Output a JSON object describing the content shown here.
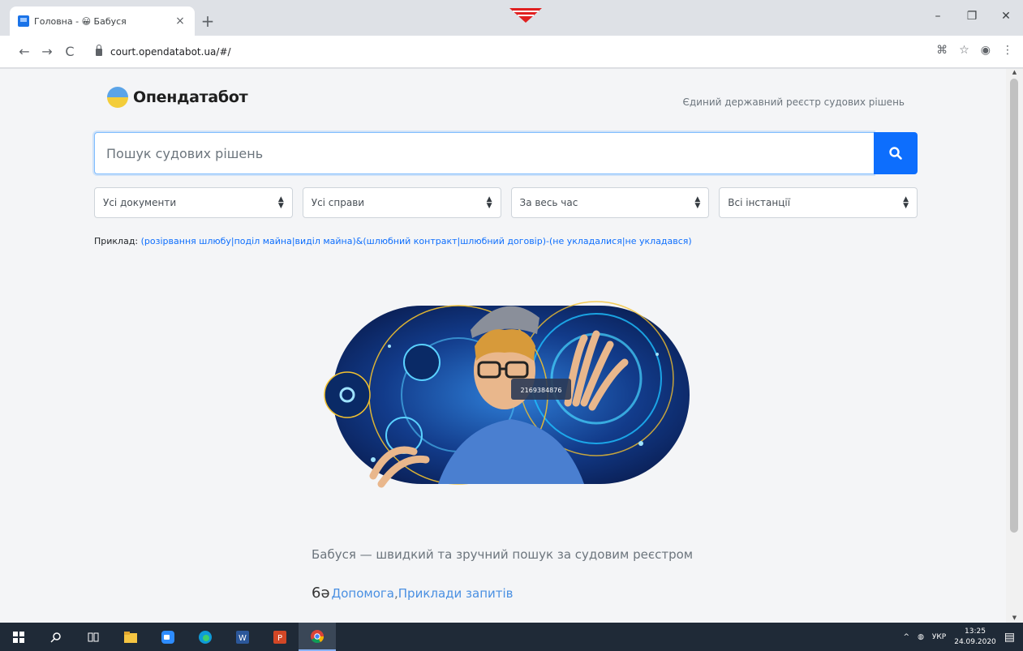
{
  "browser": {
    "tab_title": "Головна - 😀 Бабуся",
    "tab_close": "×",
    "new_tab": "+",
    "url": "court.opendatabot.ua/#/",
    "window_controls": {
      "minimize": "–",
      "restore": "❐",
      "close": "✕"
    }
  },
  "header": {
    "logo_text": "Опендатабот",
    "registry_link": "Єдиний державний реєстр судових рішень"
  },
  "search": {
    "placeholder": "Пошук судових рішень"
  },
  "filters": [
    {
      "label": "Усі документи"
    },
    {
      "label": "Усі справи"
    },
    {
      "label": "За весь час"
    },
    {
      "label": "Всі інстанції"
    }
  ],
  "example": {
    "label": "Приклад:",
    "query": "(розірвання шлюбу|поділ майна|виділ майна)&(шлюбний контракт|шлюбний договір)-(не укладалися|не укладався)"
  },
  "hero": {
    "badge_text": "2169384876"
  },
  "tagline": "Бабуся — швидкий та зручний пошук за судовим реєстром",
  "help": {
    "glyph": "6ə",
    "help_link": "Допомога",
    "separator": ", ",
    "examples_link": "Приклади запитів"
  },
  "taskbar": {
    "lang": "УКР",
    "time": "13:25",
    "date": "24.09.2020"
  },
  "colors": {
    "accent": "#0d6efd",
    "link": "#0d6efd",
    "taskbar": "#1f2a37"
  }
}
